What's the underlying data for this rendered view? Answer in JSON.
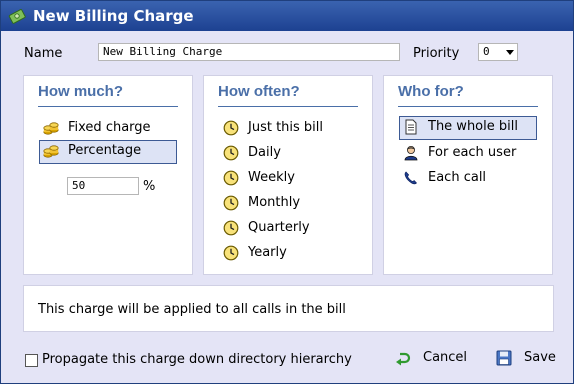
{
  "window": {
    "title": "New Billing Charge"
  },
  "form": {
    "name_label": "Name",
    "name_value": "New Billing Charge",
    "priority_label": "Priority",
    "priority_value": "0"
  },
  "how_much": {
    "heading": "How much?",
    "options": [
      {
        "label": "Fixed charge",
        "icon": "coins-icon",
        "selected": false
      },
      {
        "label": "Percentage",
        "icon": "coins-icon",
        "selected": true
      }
    ],
    "percentage_value": "50",
    "percent_sign": "%"
  },
  "how_often": {
    "heading": "How often?",
    "options": [
      {
        "label": "Just this bill",
        "icon": "clock-icon"
      },
      {
        "label": "Daily",
        "icon": "clock-icon"
      },
      {
        "label": "Weekly",
        "icon": "clock-icon"
      },
      {
        "label": "Monthly",
        "icon": "clock-icon"
      },
      {
        "label": "Quarterly",
        "icon": "clock-icon"
      },
      {
        "label": "Yearly",
        "icon": "clock-icon"
      }
    ]
  },
  "who_for": {
    "heading": "Who for?",
    "options": [
      {
        "label": "The whole bill",
        "icon": "document-icon",
        "selected": true
      },
      {
        "label": "For each user",
        "icon": "user-icon",
        "selected": false
      },
      {
        "label": "Each call",
        "icon": "phone-icon",
        "selected": false
      }
    ]
  },
  "info_text": "This charge will be applied to all calls in the bill",
  "footer": {
    "propagate_label": "Propagate this charge down directory hierarchy",
    "propagate_checked": false,
    "cancel_label": "Cancel",
    "save_label": "Save"
  },
  "colors": {
    "titlebar": "#2a52a0",
    "heading": "#4a6fa8",
    "selected_bg": "#dde3f5",
    "body_bg": "#e4e4f6"
  }
}
